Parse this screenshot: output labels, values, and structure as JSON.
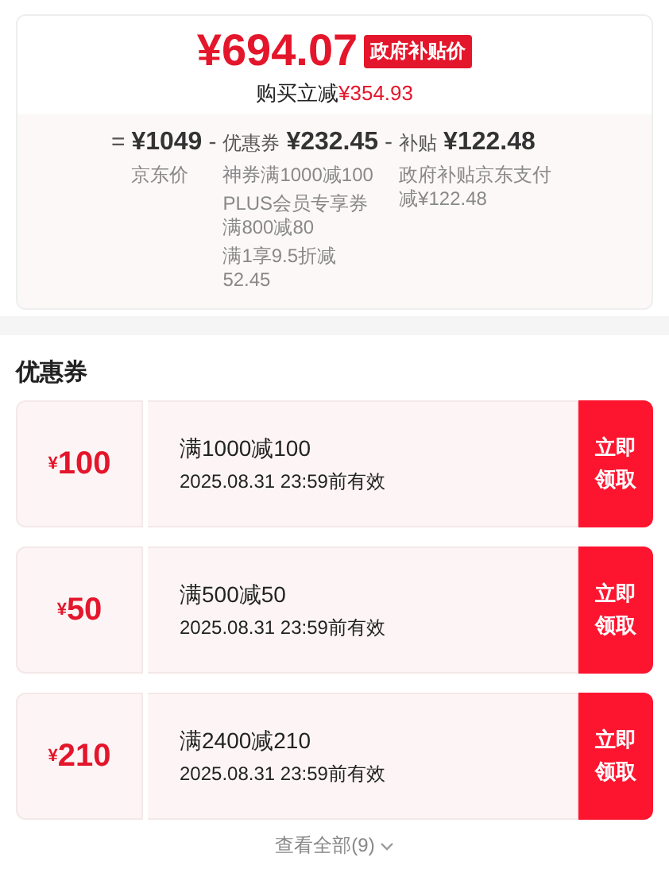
{
  "price": {
    "amount": "¥694.07",
    "badge": "政府补贴价",
    "saving_label": "购买立减",
    "saving_amount": "¥354.93"
  },
  "breakdown": [
    {
      "operator": "=",
      "amount": "¥1049",
      "notes": [
        "京东价"
      ]
    },
    {
      "operator": "-",
      "label": "优惠券",
      "amount": "¥232.45",
      "notes": [
        "神券满1000减100",
        "PLUS会员专享券满800减80",
        "满1享9.5折减52.45"
      ]
    },
    {
      "operator": "-",
      "label": "补贴",
      "amount": "¥122.48",
      "notes": [
        "政府补贴京东支付减¥122.48"
      ]
    }
  ],
  "coupons_section": {
    "title": "优惠券",
    "coupons": [
      {
        "currency": "¥",
        "value": "100",
        "condition": "满1000减100",
        "validity": "2025.08.31 23:59前有效",
        "button": "立即领取"
      },
      {
        "currency": "¥",
        "value": "50",
        "condition": "满500减50",
        "validity": "2025.08.31 23:59前有效",
        "button": "立即领取"
      },
      {
        "currency": "¥",
        "value": "210",
        "condition": "满2400减210",
        "validity": "2025.08.31 23:59前有效",
        "button": "立即领取"
      }
    ],
    "view_all": "查看全部(9)"
  }
}
